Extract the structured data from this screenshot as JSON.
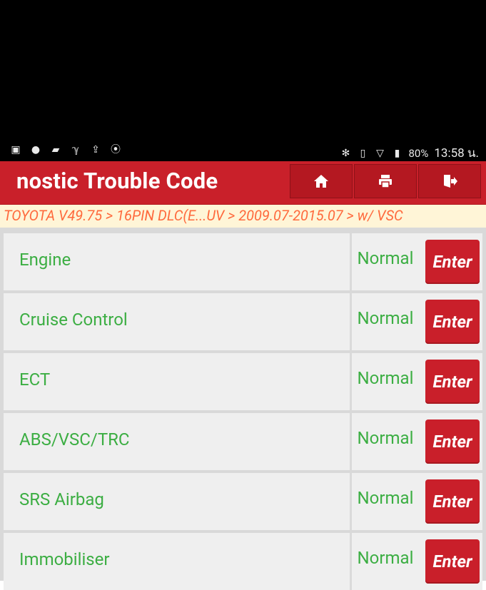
{
  "statusbar": {
    "battery": "80%",
    "time": "13:58 น.",
    "left_icons": [
      "gallery-icon",
      "chat-icon",
      "image-icon",
      "stethoscope-icon",
      "upload-icon",
      "bluetooth-app-icon"
    ],
    "right_icons": [
      "bluetooth-icon",
      "vibrate-icon",
      "wifi-icon",
      "battery-icon"
    ]
  },
  "header": {
    "title": "nostic Trouble Code",
    "buttons": [
      "home-icon",
      "print-icon",
      "exit-icon"
    ]
  },
  "breadcrumb": "TOYOTA V49.75 > 16PIN DLC(E...UV > 2009.07-2015.07 > w/ VSC",
  "rows": [
    {
      "name": "Engine",
      "status": "Normal",
      "enter": "Enter"
    },
    {
      "name": "Cruise Control",
      "status": "Normal",
      "enter": "Enter"
    },
    {
      "name": "ECT",
      "status": "Normal",
      "enter": "Enter"
    },
    {
      "name": "ABS/VSC/TRC",
      "status": "Normal",
      "enter": "Enter"
    },
    {
      "name": "SRS Airbag",
      "status": "Normal",
      "enter": "Enter"
    },
    {
      "name": "Immobiliser",
      "status": "Normal",
      "enter": "Enter"
    }
  ],
  "colors": {
    "header": "#c9202a",
    "accent_text": "#3cae43",
    "breadcrumb_bg": "#fff5d7",
    "breadcrumb_text": "#ff6a3d"
  }
}
